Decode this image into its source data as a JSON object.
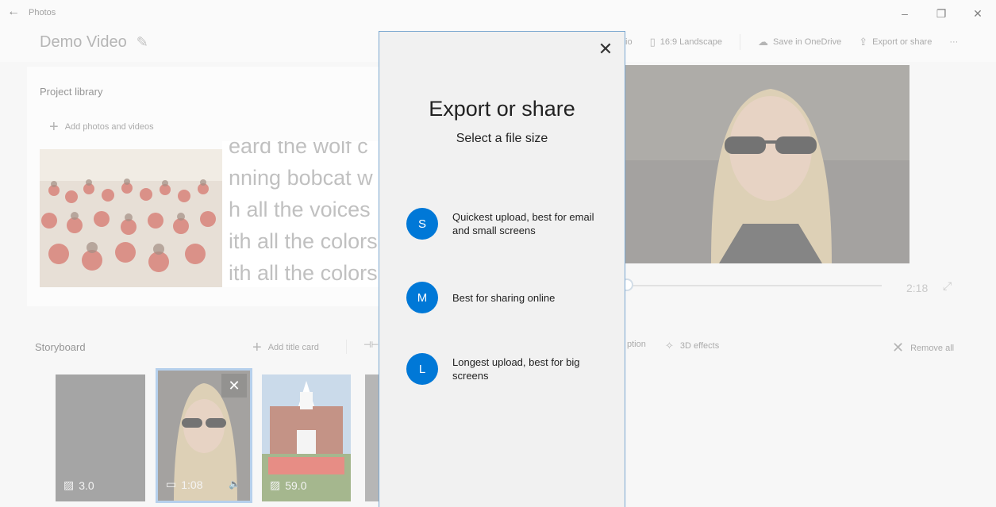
{
  "titlebar": {
    "app_name": "Photos",
    "back_glyph": "←",
    "minimize_glyph": "–",
    "restore_glyph": "❐",
    "close_glyph": "✕"
  },
  "header": {
    "project_title": "Demo Video",
    "toolbar": {
      "aspect_partial": "io",
      "aspect_label": "16:9 Landscape",
      "onedrive_label": "Save in OneDrive",
      "export_label": "Export or share",
      "more_glyph": "···"
    }
  },
  "library": {
    "title": "Project library",
    "add_label": "Add photos and videos",
    "lyrics": [
      "eard the wolf c",
      "nning bobcat w",
      "h all the voices",
      "ith all the colors",
      "ith all the colors"
    ]
  },
  "preview": {
    "duration": "2:18",
    "progress_fraction": 0.0
  },
  "storyboard": {
    "title": "Storyboard",
    "add_title_card": "Add title card",
    "tool_partial_text": "ption",
    "effects_3d": "3D effects",
    "remove_all": "Remove all",
    "clips": [
      {
        "duration": "3.0",
        "type": "image"
      },
      {
        "duration": "1:08",
        "type": "video"
      },
      {
        "duration": "59.0",
        "type": "image"
      }
    ]
  },
  "dialog": {
    "title": "Export or share",
    "subtitle": "Select a file size",
    "close_glyph": "✕",
    "options": [
      {
        "letter": "S",
        "text": "Quickest upload, best for email and small screens"
      },
      {
        "letter": "M",
        "text": "Best for sharing online"
      },
      {
        "letter": "L",
        "text": "Longest upload, best for big screens"
      }
    ],
    "accent_color": "#0078d7"
  }
}
